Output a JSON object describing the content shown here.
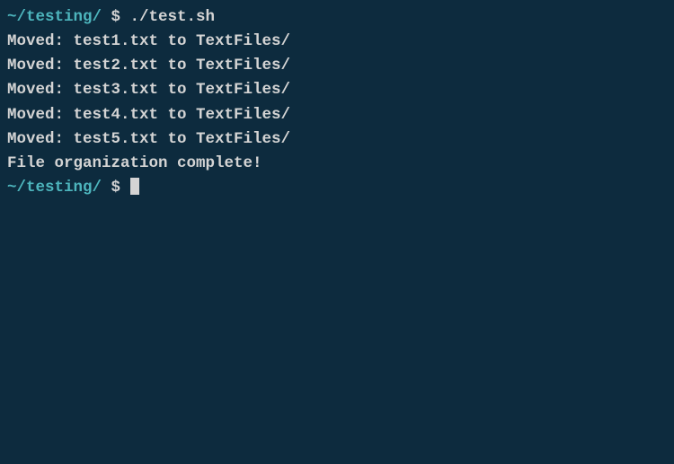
{
  "prompt1": {
    "path": "~/testing/",
    "symbol": " $ ",
    "command": "./test.sh"
  },
  "output": {
    "line1": "Moved: test1.txt to TextFiles/",
    "line2": "Moved: test2.txt to TextFiles/",
    "line3": "Moved: test3.txt to TextFiles/",
    "line4": "Moved: test4.txt to TextFiles/",
    "line5": "Moved: test5.txt to TextFiles/",
    "line6": "File organization complete!"
  },
  "prompt2": {
    "path": "~/testing/",
    "symbol": " $ "
  }
}
